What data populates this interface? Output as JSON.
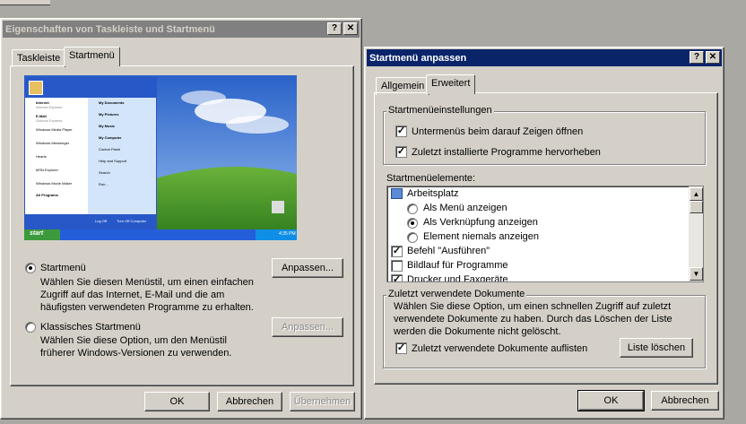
{
  "dialog1": {
    "title": "Eigenschaften von Taskleiste und Startmenü",
    "help": "?",
    "close": "✕",
    "tabs": [
      "Taskleiste",
      "Startmenü"
    ],
    "preview": {
      "user_pinned": [
        "Internet",
        "E-Mail",
        "Windows Media Player",
        "Windows Messenger",
        "Hearts",
        "MSN Explorer",
        "Windows Movie Maker"
      ],
      "user_pinned_sub": [
        "Internet Explorer",
        "Outlook Express"
      ],
      "right_items": [
        "My Documents",
        "My Pictures",
        "My Music",
        "My Computer",
        "Control Panel",
        "Help and Support",
        "Search",
        "Run..."
      ],
      "all_programs": "All Programs",
      "logoff": "Log Off",
      "turnoff": "Turn Off Computer",
      "start": "start",
      "clock": "4:35 PM"
    },
    "opt1_label": "Startmenü",
    "opt1_desc": [
      "Wählen Sie diesen Menüstil, um einen einfachen",
      "Zugriff auf das Internet, E-Mail und die am",
      "häufigsten verwendeten Programme zu erhalten."
    ],
    "opt1_button": "Anpassen...",
    "opt2_label": "Klassisches Startmenü",
    "opt2_desc": [
      "Wählen Sie diese Option, um den Menüstil",
      "früherer Windows-Versionen zu verwenden."
    ],
    "opt2_button": "Anpassen...",
    "ok": "OK",
    "cancel": "Abbrechen",
    "apply": "Übernehmen"
  },
  "dialog2": {
    "title": "Startmenü anpassen",
    "help": "?",
    "close": "✕",
    "tabs": [
      "Allgemein",
      "Erweitert"
    ],
    "settings_group": "Startmenüeinstellungen",
    "settings": [
      {
        "label": "Untermenüs beim darauf Zeigen öffnen",
        "checked": true
      },
      {
        "label": "Zuletzt installierte Programme hervorheben",
        "checked": true
      }
    ],
    "items_label": "Startmenüelemente:",
    "list": {
      "root": "Arbeitsplatz",
      "options": [
        {
          "label": "Als Menü anzeigen",
          "selected": false
        },
        {
          "label": "Als Verknüpfung anzeigen",
          "selected": true
        },
        {
          "label": "Element niemals anzeigen",
          "selected": false
        }
      ],
      "checks": [
        {
          "label": "Befehl \"Ausführen\"",
          "checked": true
        },
        {
          "label": "Bildlauf für Programme",
          "checked": false
        },
        {
          "label": "Drucker und Faxgeräte",
          "checked": true
        }
      ]
    },
    "recent_group": "Zuletzt verwendete Dokumente",
    "recent_desc": [
      "Wählen Sie diese Option, um einen schnellen Zugriff auf zuletzt",
      "verwendete Dokumente zu haben. Durch das Löschen der Liste",
      "werden die Dokumente nicht gelöscht."
    ],
    "recent_check": "Zuletzt verwendete Dokumente auflisten",
    "recent_checked": true,
    "clear_button": "Liste löschen",
    "ok": "OK",
    "cancel": "Abbrechen"
  },
  "colors": {
    "face": "#d4d0c8",
    "active_title": "#0a246a",
    "inactive_title": "#808080"
  }
}
